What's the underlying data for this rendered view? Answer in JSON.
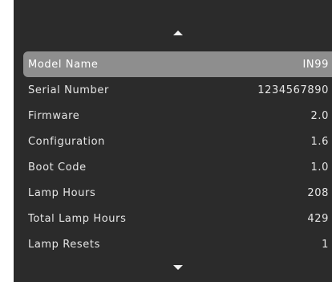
{
  "menu": {
    "scroll_up_icon": "triangle-up",
    "scroll_down_icon": "triangle-down",
    "items": [
      {
        "label": "Model Name",
        "value": "IN99"
      },
      {
        "label": "Serial Number",
        "value": "1234567890"
      },
      {
        "label": "Firmware",
        "value": "2.0"
      },
      {
        "label": "Configuration",
        "value": "1.6"
      },
      {
        "label": "Boot Code",
        "value": "1.0"
      },
      {
        "label": "Lamp Hours",
        "value": "208"
      },
      {
        "label": "Total Lamp Hours",
        "value": "429"
      },
      {
        "label": "Lamp Resets",
        "value": "1"
      }
    ],
    "selected_index": 0
  },
  "colors": {
    "panel_background": "#2b2b2b",
    "selected_row": "#8e8e8e",
    "text": "#e6e6e6"
  }
}
